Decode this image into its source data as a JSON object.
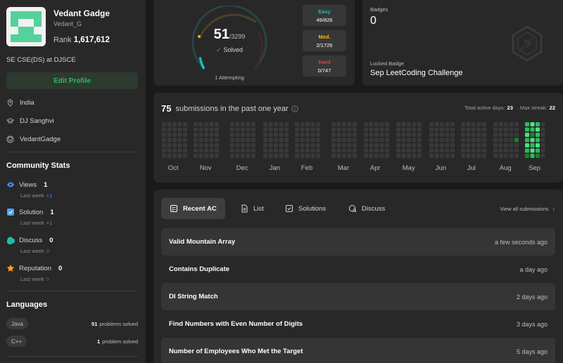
{
  "profile": {
    "name": "Vedant Gadge",
    "handle": "Vedant_G",
    "rank_label": "Rank",
    "rank": "1,617,612",
    "bio": "SE CSE(DS) at DJSCE",
    "edit_label": "Edit Profile",
    "location": "India",
    "school": "DJ Sanghvi",
    "github": "VedantGadge"
  },
  "community": {
    "title": "Community Stats",
    "items": [
      {
        "label": "Views",
        "value": "1",
        "sub_label": "Last week",
        "sub_value": "+1",
        "color": "#3e8ef7"
      },
      {
        "label": "Solution",
        "value": "1",
        "sub_label": "Last week",
        "sub_value": "+1",
        "color": "#48a3f7"
      },
      {
        "label": "Discuss",
        "value": "0",
        "sub_label": "Last week",
        "sub_value": "0",
        "color": "#22b8a6"
      },
      {
        "label": "Reputation",
        "value": "0",
        "sub_label": "Last week",
        "sub_value": "0",
        "color": "#ffa116"
      }
    ]
  },
  "languages": {
    "title": "Languages",
    "items": [
      {
        "name": "Java",
        "count": "51",
        "suffix": "problems solved"
      },
      {
        "name": "C++",
        "count": "1",
        "suffix": "problem solved"
      }
    ]
  },
  "progress": {
    "solved": "51",
    "total": "/3299",
    "solved_label": "Solved",
    "attempting": "1 Attempting",
    "easy": {
      "label": "Easy",
      "value": "49/826",
      "color": "#1cbaba"
    },
    "medium": {
      "label": "Med.",
      "value": "2/1726",
      "color": "#ffb700"
    },
    "hard": {
      "label": "Hard",
      "value": "0/747",
      "color": "#f63737"
    }
  },
  "badges": {
    "label": "Badges",
    "count": "0",
    "locked_label": "Locked Badge",
    "locked_name": "Sep LeetCoding Challenge"
  },
  "heatmap": {
    "count": "75",
    "title": "submissions in the past one year",
    "active_label": "Total active days:",
    "active_value": "23",
    "streak_label": "Max streak:",
    "streak_value": "22",
    "months": [
      "Oct",
      "Nov",
      "Dec",
      "Jan",
      "Feb",
      "Mar",
      "Apr",
      "May",
      "Jun",
      "Jul",
      "Aug",
      "Sep"
    ],
    "colors": {
      "empty": "#393939",
      "l1": "#0e4429",
      "l2": "#1a7f37",
      "l3": "#2cbb5d",
      "l4": "#4ee27c"
    }
  },
  "recent": {
    "tabs": [
      {
        "label": "Recent AC",
        "icon": "recent-ac-icon"
      },
      {
        "label": "List",
        "icon": "list-icon"
      },
      {
        "label": "Solutions",
        "icon": "solutions-icon"
      },
      {
        "label": "Discuss",
        "icon": "discuss-icon"
      }
    ],
    "view_all": "View all submissions",
    "rows": [
      {
        "title": "Valid Mountain Array",
        "time": "a few seconds ago"
      },
      {
        "title": "Contains Duplicate",
        "time": "a day ago"
      },
      {
        "title": "DI String Match",
        "time": "2 days ago"
      },
      {
        "title": "Find Numbers with Even Number of Digits",
        "time": "3 days ago"
      },
      {
        "title": "Number of Employees Who Met the Target",
        "time": "5 days ago"
      }
    ]
  }
}
